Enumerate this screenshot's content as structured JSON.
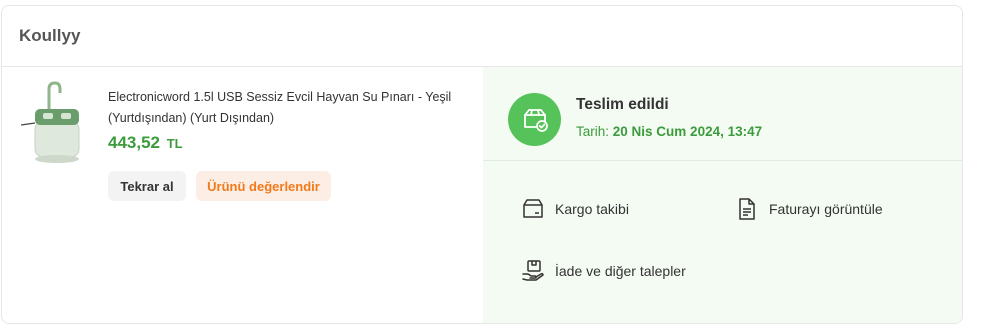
{
  "order": {
    "shop_name": "Koullyy",
    "product": {
      "title": "Electronicword 1.5l USB Sessiz Evcil Hayvan Su Pınarı - Yeşil (Yurtdışından) (Yurt Dışından)",
      "price": "443,52",
      "currency": "TL",
      "image_icon": "pet-water-fountain-image"
    },
    "buttons": {
      "buy_again": "Tekrar al",
      "rate_product": "Ürünü değerlendir"
    },
    "status": {
      "title": "Teslim edildi",
      "date_label": "Tarih:",
      "date_value": "20 Nis Cum 2024, 13:47",
      "icon": "delivered-box-check-icon"
    },
    "actions": {
      "tracking": "Kargo takibi",
      "invoice": "Faturayı görüntüle",
      "returns": "İade ve diğer talepler"
    },
    "colors": {
      "accent_green": "#3c9b3d",
      "status_green": "#56c25a",
      "orange": "#f27a1a",
      "panel_bg": "#f4fbf3"
    }
  }
}
